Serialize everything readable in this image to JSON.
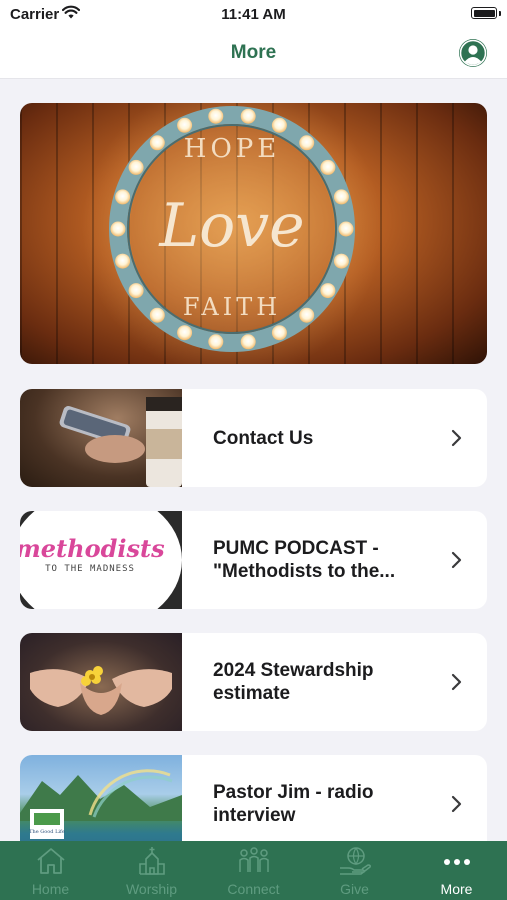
{
  "status_bar": {
    "carrier": "Carrier",
    "time": "11:41 AM"
  },
  "nav": {
    "title": "More",
    "profile_icon": "person-circle-icon"
  },
  "hero": {
    "lines": [
      "HOPE",
      "Love",
      "FAITH"
    ]
  },
  "items": [
    {
      "title": "Contact Us",
      "thumbnail": "phone-and-coffee-photo"
    },
    {
      "title": "PUMC PODCAST - \"Methodists to the...",
      "thumbnail_text": [
        "methodists",
        "TO THE MADNESS"
      ]
    },
    {
      "title": "2024 Stewardship estimate",
      "thumbnail": "hands-holding-flower-photo"
    },
    {
      "title": "Pastor Jim - radio interview",
      "thumbnail": "rainbow-mountain-photo",
      "thumbnail_badge": "The Good Life"
    }
  ],
  "tabs": [
    {
      "label": "Home",
      "icon": "home-icon",
      "active": false
    },
    {
      "label": "Worship",
      "icon": "church-icon",
      "active": false
    },
    {
      "label": "Connect",
      "icon": "people-icon",
      "active": false
    },
    {
      "label": "Give",
      "icon": "give-hand-globe-icon",
      "active": false
    },
    {
      "label": "More",
      "icon": "more-dots-icon",
      "active": true
    }
  ],
  "colors": {
    "brand_green": "#2e7252",
    "inactive_tab": "#5f9c80",
    "background": "#f2f2f7"
  }
}
